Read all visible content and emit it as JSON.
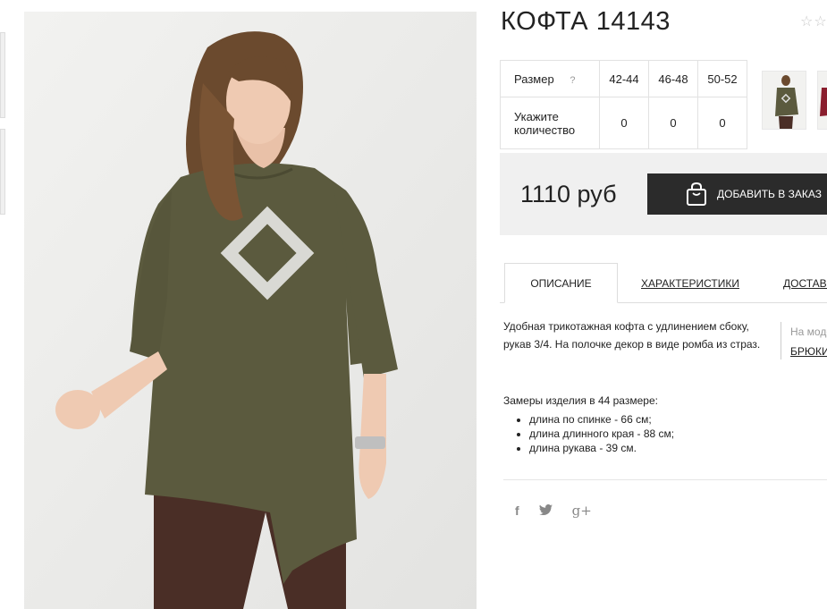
{
  "product": {
    "title": "КОФТА 14143",
    "rating_stars": "☆☆"
  },
  "size_table": {
    "size_label": "Размер",
    "help": "?",
    "sizes": [
      "42-44",
      "46-48",
      "50-52"
    ],
    "qty_label": "Укажите количество",
    "quantities": [
      "0",
      "0",
      "0"
    ]
  },
  "purchase": {
    "price": "1110 руб",
    "add_to_order": "ДОБАВИТЬ В ЗАКАЗ"
  },
  "tabs": [
    {
      "label": "ОПИСАНИЕ"
    },
    {
      "label": "ХАРАКТЕРИСТИКИ"
    },
    {
      "label": "ДОСТАВКА"
    }
  ],
  "description": {
    "text": "Удобная трикотажная кофта с удлинением сбоку, рукав 3/4. На полочке декор в виде ромба из страз.",
    "measurements_title": "Замеры изделия в 44 размере:",
    "measurements": [
      "длина по спинке - 66 см;",
      "длина длинного края - 88 см;",
      "длина рукава - 39 см."
    ]
  },
  "side_note": {
    "label": "На модели:",
    "link": "БРЮКИ"
  },
  "social": {
    "facebook": "f",
    "twitter": "🐦",
    "google_plus": "g+"
  },
  "colors": {
    "button_bg": "#2b2b2b",
    "sweater": "#5b5a3e",
    "pants": "#4a2e26"
  }
}
